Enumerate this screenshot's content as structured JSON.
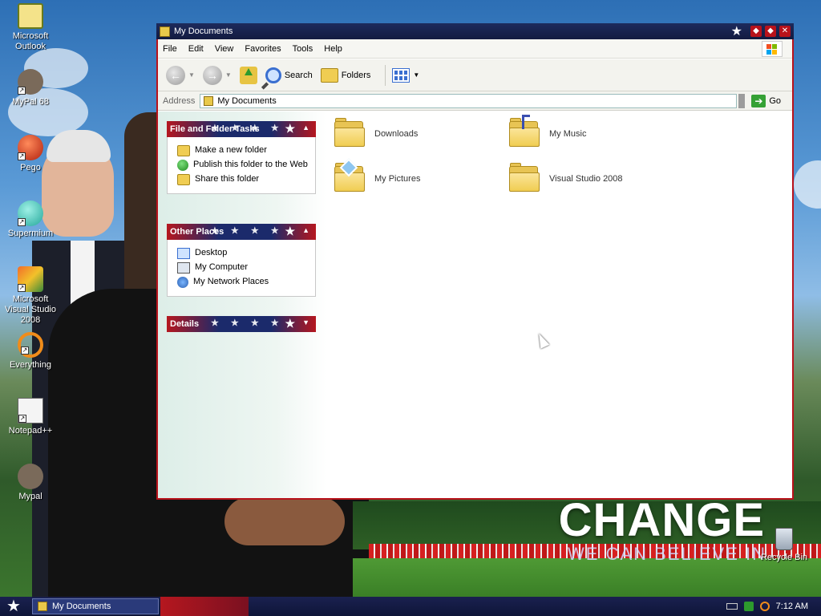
{
  "desktop": {
    "icons": [
      {
        "label": "Microsoft Outlook"
      },
      {
        "label": "MyPal 68"
      },
      {
        "label": "Pego"
      },
      {
        "label": "Supermium"
      },
      {
        "label": "Microsoft Visual Studio 2008"
      },
      {
        "label": "Everything"
      },
      {
        "label": "Notepad++"
      },
      {
        "label": "Mypal"
      }
    ],
    "recycle_bin": "Recycle Bin",
    "slogan_main": "CHANGE",
    "slogan_sub": "WE CAN BELIEVE IN"
  },
  "window": {
    "title": "My Documents",
    "menu": [
      "File",
      "Edit",
      "View",
      "Favorites",
      "Tools",
      "Help"
    ],
    "toolbar": {
      "back_glyph": "←",
      "forward_glyph": "→",
      "search_label": "Search",
      "folders_label": "Folders"
    },
    "address": {
      "label": "Address",
      "value": "My Documents",
      "go_label": "Go"
    },
    "tasks": {
      "file_folder": {
        "title": "File and Folder Tasks",
        "items": [
          "Make a new folder",
          "Publish this folder to the Web",
          "Share this folder"
        ]
      },
      "other_places": {
        "title": "Other Places",
        "items": [
          "Desktop",
          "My Computer",
          "My Network Places"
        ]
      },
      "details": {
        "title": "Details"
      }
    },
    "items": [
      {
        "name": "Downloads"
      },
      {
        "name": "My Music"
      },
      {
        "name": "My Pictures"
      },
      {
        "name": "Visual Studio 2008"
      }
    ]
  },
  "taskbar": {
    "task_label": "My Documents",
    "clock": "7:12 AM"
  },
  "colors": {
    "titlebar": "#1d2a5c",
    "accent_red": "#b8121b",
    "folder": "#e8c454"
  }
}
